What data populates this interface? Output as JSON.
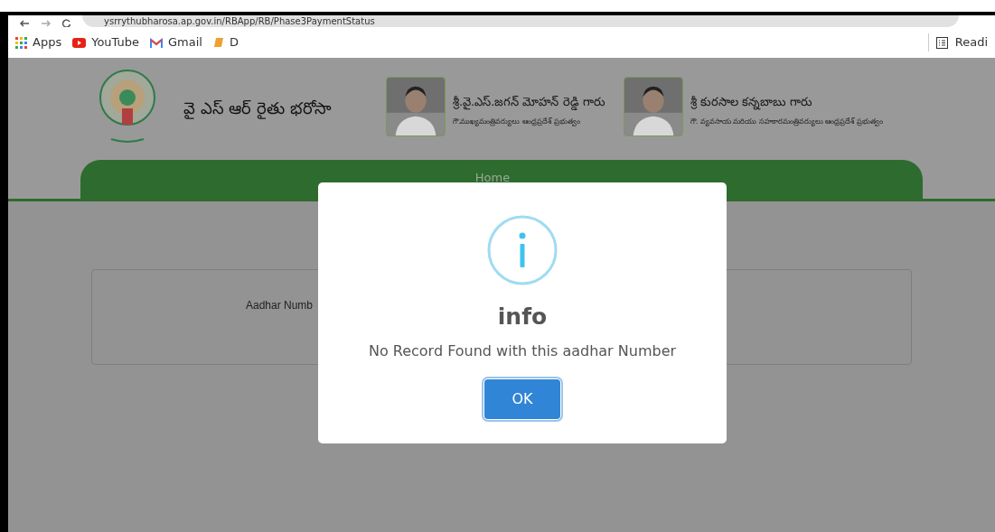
{
  "browser": {
    "url": "ysrrythubharosa.ap.gov.in/RBApp/RB/Phase3PaymentStatus",
    "bookmarks": [
      {
        "kind": "apps",
        "label": "Apps"
      },
      {
        "kind": "youtube",
        "label": "YouTube"
      },
      {
        "kind": "gmail",
        "label": "Gmail"
      },
      {
        "kind": "folder",
        "label": "D"
      }
    ],
    "reading_list": "Readi"
  },
  "header": {
    "site_title": "వై ఎస్ ఆర్ రైతు భరోసా",
    "people": [
      {
        "name": "శ్రీ.వై.ఎస్.జగన్ మోహన్ రెడ్డి గారు",
        "role": "గౌ.ముఖ్యమంత్రివర్యులు ఆంధ్రప్రదేశ్ ప్రభుత్వం"
      },
      {
        "name": "శ్రీ కురసాల కన్నబాబు గారు",
        "role": "గౌ. వ్యవసాయ మరియు సహకారమంత్రివర్యులు ఆంధ్రప్రదేశ్ ప్రభుత్వం"
      }
    ]
  },
  "nav": {
    "items": [
      "Home"
    ]
  },
  "form": {
    "label": "Aadhar Numb"
  },
  "dialog": {
    "title": "info",
    "message": "No Record Found with this aadhar Number",
    "button": "OK"
  }
}
